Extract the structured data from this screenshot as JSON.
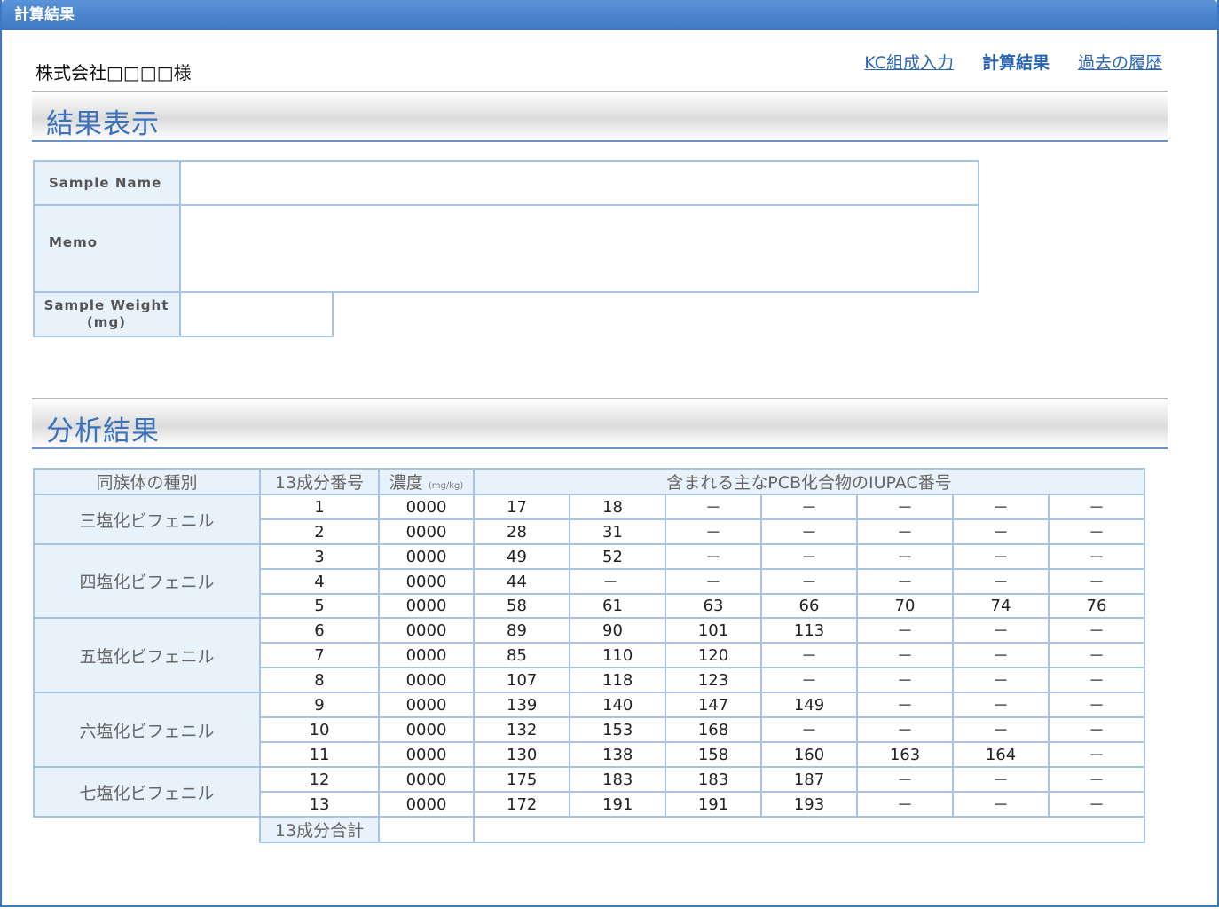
{
  "window": {
    "title": "計算結果"
  },
  "header": {
    "client": "株式会社□□□□様",
    "nav": [
      {
        "label": "KC組成入力",
        "current": false
      },
      {
        "label": "計算結果",
        "current": true
      },
      {
        "label": "過去の履歴",
        "current": false
      }
    ]
  },
  "result_section": {
    "title": "結果表示"
  },
  "form": {
    "sample_name_label": "Sample Name",
    "sample_name_value": "",
    "memo_label": "Memo",
    "memo_value": "",
    "sample_weight_label_1": "Sample Weight",
    "sample_weight_label_2": "(mg)",
    "sample_weight_value": ""
  },
  "analysis_section": {
    "title": "分析結果"
  },
  "analysis_table": {
    "headers": {
      "group": "同族体の種別",
      "component_no": "13成分番号",
      "concentration": "濃度",
      "concentration_unit": "(mg/kg)",
      "iupac": "含まれる主なPCB化合物のIUPAC番号"
    },
    "groups": [
      {
        "name": "三塩化ビフェニル",
        "rows": [
          {
            "no": "1",
            "conc": "0000",
            "iupac": [
              "17",
              "18",
              "－",
              "－",
              "－",
              "－",
              "－"
            ]
          },
          {
            "no": "2",
            "conc": "0000",
            "iupac": [
              "28",
              "31",
              "－",
              "－",
              "－",
              "－",
              "－"
            ]
          }
        ]
      },
      {
        "name": "四塩化ビフェニル",
        "rows": [
          {
            "no": "3",
            "conc": "0000",
            "iupac": [
              "49",
              "52",
              "－",
              "－",
              "－",
              "－",
              "－"
            ]
          },
          {
            "no": "4",
            "conc": "0000",
            "iupac": [
              "44",
              "－",
              "－",
              "－",
              "－",
              "－",
              "－"
            ]
          },
          {
            "no": "5",
            "conc": "0000",
            "iupac": [
              "58",
              "61",
              "63",
              "66",
              "70",
              "74",
              "76"
            ]
          }
        ]
      },
      {
        "name": "五塩化ビフェニル",
        "rows": [
          {
            "no": "6",
            "conc": "0000",
            "iupac": [
              "89",
              "90",
              "101",
              "113",
              "－",
              "－",
              "－"
            ]
          },
          {
            "no": "7",
            "conc": "0000",
            "iupac": [
              "85",
              "110",
              "120",
              "－",
              "－",
              "－",
              "－"
            ]
          },
          {
            "no": "8",
            "conc": "0000",
            "iupac": [
              "107",
              "118",
              "123",
              "－",
              "－",
              "－",
              "－"
            ]
          }
        ]
      },
      {
        "name": "六塩化ビフェニル",
        "rows": [
          {
            "no": "9",
            "conc": "0000",
            "iupac": [
              "139",
              "140",
              "147",
              "149",
              "－",
              "－",
              "－"
            ]
          },
          {
            "no": "10",
            "conc": "0000",
            "iupac": [
              "132",
              "153",
              "168",
              "－",
              "－",
              "－",
              "－"
            ]
          },
          {
            "no": "11",
            "conc": "0000",
            "iupac": [
              "130",
              "138",
              "158",
              "160",
              "163",
              "164",
              "－"
            ]
          }
        ]
      },
      {
        "name": "七塩化ビフェニル",
        "rows": [
          {
            "no": "12",
            "conc": "0000",
            "iupac": [
              "175",
              "183",
              "183",
              "187",
              "－",
              "－",
              "－"
            ]
          },
          {
            "no": "13",
            "conc": "0000",
            "iupac": [
              "172",
              "191",
              "191",
              "193",
              "－",
              "－",
              "－"
            ]
          }
        ]
      }
    ],
    "total_label": "13成分合計",
    "total_value": ""
  }
}
